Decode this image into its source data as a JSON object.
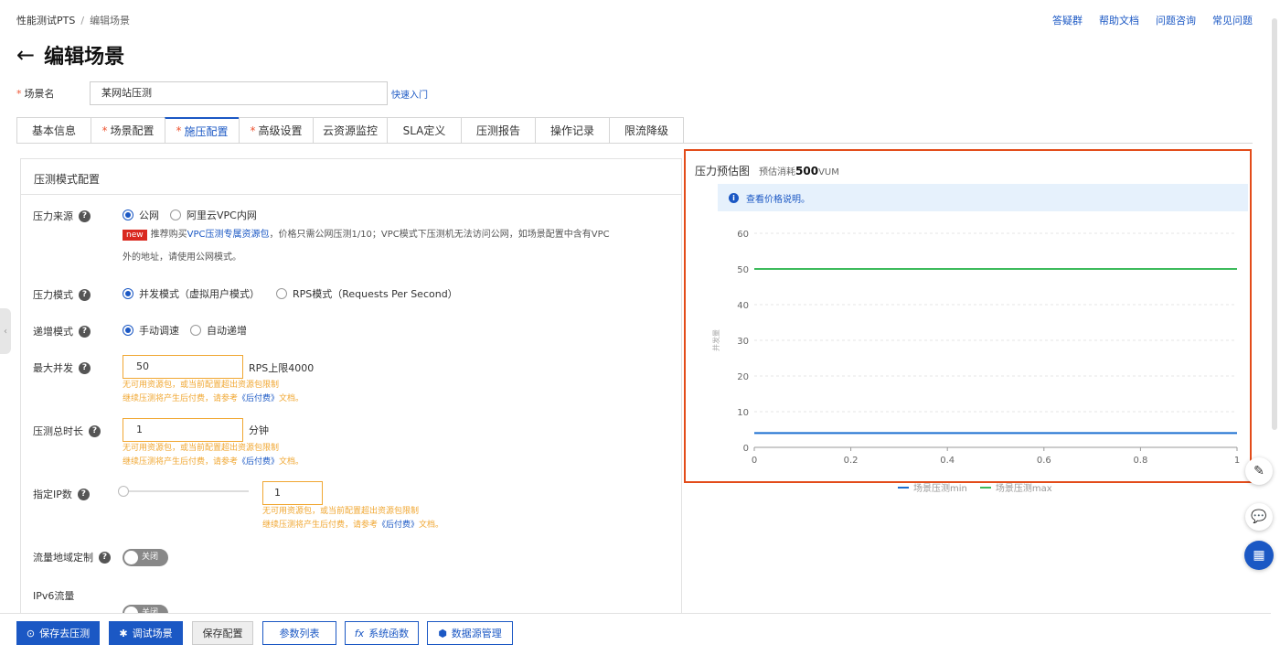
{
  "breadcrumb": {
    "root": "性能测试PTS",
    "separator": "/",
    "current": "编辑场景"
  },
  "top_links": [
    "答疑群",
    "帮助文档",
    "问题咨询",
    "常见问题"
  ],
  "page_title": "编辑场景",
  "scene_name": {
    "label": "场景名",
    "value": "某网站压测",
    "quick_start": "快速入门"
  },
  "tabs": [
    {
      "label": "基本信息",
      "required": false,
      "active": false
    },
    {
      "label": "场景配置",
      "required": true,
      "active": false
    },
    {
      "label": "施压配置",
      "required": true,
      "active": true
    },
    {
      "label": "高级设置",
      "required": true,
      "active": false
    },
    {
      "label": "云资源监控",
      "required": false,
      "active": false
    },
    {
      "label": "SLA定义",
      "required": false,
      "active": false
    },
    {
      "label": "压测报告",
      "required": false,
      "active": false
    },
    {
      "label": "操作记录",
      "required": false,
      "active": false
    },
    {
      "label": "限流降级",
      "required": false,
      "active": false
    }
  ],
  "form": {
    "section_title": "压测模式配置",
    "pressure_source": {
      "label": "压力来源",
      "options": [
        "公网",
        "阿里云VPC内网"
      ],
      "selected": "公网",
      "new_badge": "new",
      "note_prefix": "推荐购买",
      "note_link": "VPC压测专属资源包",
      "note_rest": "，价格只需公网压测1/10；VPC模式下压测机无法访问公网，如场景配置中含有VPC",
      "note_line2": "外的地址，请使用公网模式。"
    },
    "pressure_mode": {
      "label": "压力模式",
      "options": [
        "并发模式（虚拟用户模式）",
        "RPS模式（Requests Per Second）"
      ],
      "selected": "并发模式（虚拟用户模式）"
    },
    "ramp_mode": {
      "label": "递增模式",
      "options": [
        "手动调速",
        "自动递增"
      ],
      "selected": "手动调速"
    },
    "max_concurrency": {
      "label": "最大并发",
      "value": "50",
      "unit": "RPS上限4000"
    },
    "duration": {
      "label": "压测总时长",
      "value": "1",
      "unit": "分钟"
    },
    "ip_count": {
      "label": "指定IP数",
      "value": "1",
      "slider_level": 0
    },
    "warning_line1": "无可用资源包，或当前配置超出资源包限制",
    "warning_line2_prefix": "继续压测将产生后付费，请参考",
    "warning_link": "《后付费》",
    "warning_line2_suffix": "文档。",
    "region_custom": {
      "label": "流量地域定制",
      "state": "关闭"
    },
    "ipv6": {
      "label": "IPv6流量",
      "state": "关闭"
    }
  },
  "chart_panel": {
    "title": "压力预估图",
    "cost_prefix": "预估消耗",
    "cost_value": "500",
    "cost_unit": "VUM",
    "info_text": "查看价格说明。",
    "y_axis_label": "并发量"
  },
  "chart_data": {
    "type": "line",
    "x": [
      0,
      1
    ],
    "xlim": [
      0,
      1
    ],
    "xticks": [
      "0",
      "0.2",
      "0.4",
      "0.6",
      "0.8",
      "1"
    ],
    "ylim": [
      0,
      60
    ],
    "yticks": [
      "0",
      "10",
      "20",
      "30",
      "40",
      "50",
      "60"
    ],
    "ylabel": "并发量",
    "grid": true,
    "legend": "bottom",
    "series": [
      {
        "name": "场景压测min",
        "values": [
          4,
          4
        ],
        "color": "#1b6fd0"
      },
      {
        "name": "场景压测max",
        "values": [
          50,
          50
        ],
        "color": "#3dbb5c"
      }
    ]
  },
  "footer_buttons": {
    "save_start": "保存去压测",
    "debug": "调试场景",
    "save_config": "保存配置",
    "params": "参数列表",
    "functions": "系统函数",
    "data_source": "数据源管理"
  },
  "colors": {
    "accent": "#1b58c4",
    "warning": "#f0a732",
    "highlight_border": "#e34c1a"
  }
}
